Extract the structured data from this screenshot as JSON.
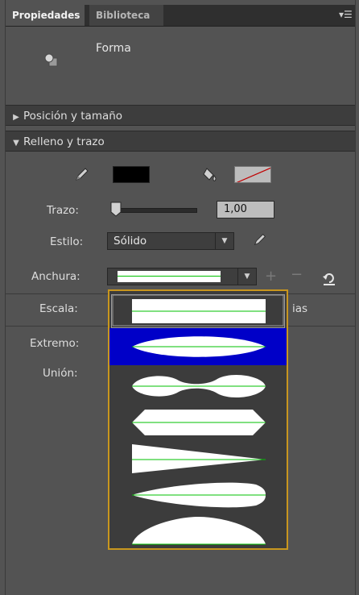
{
  "tabs": [
    {
      "label": "Propiedades",
      "active": true
    },
    {
      "label": "Biblioteca",
      "active": false
    }
  ],
  "document": {
    "label": "Forma",
    "icon": "shape-icon"
  },
  "sections": {
    "position_size": {
      "label": "Posición y tamaño",
      "expanded": false
    },
    "fill_stroke": {
      "label": "Relleno y trazo",
      "expanded": true
    }
  },
  "stroke": {
    "label": "Trazo:",
    "value": "1,00",
    "slider_fraction": 0.02
  },
  "style": {
    "label": "Estilo:",
    "value": "Sólido"
  },
  "width": {
    "label": "Anchura:"
  },
  "scale": {
    "label": "Escala:",
    "value_tail": "ias"
  },
  "cap": {
    "label": "Extremo:"
  },
  "join": {
    "label": "Unión:"
  },
  "colors": {
    "panel_bg": "#535353",
    "accent_popup_border": "#c8961e",
    "highlight": "#0000c8",
    "profile_line": "#00c000",
    "fill_color": "#000000"
  },
  "width_profiles": [
    {
      "name": "uniform",
      "selected": true,
      "highlighted": false
    },
    {
      "name": "profile-1",
      "selected": false,
      "highlighted": true
    },
    {
      "name": "profile-2",
      "selected": false,
      "highlighted": false
    },
    {
      "name": "profile-3",
      "selected": false,
      "highlighted": false
    },
    {
      "name": "profile-4",
      "selected": false,
      "highlighted": false
    },
    {
      "name": "profile-5",
      "selected": false,
      "highlighted": false
    },
    {
      "name": "profile-6",
      "selected": false,
      "highlighted": false
    }
  ]
}
